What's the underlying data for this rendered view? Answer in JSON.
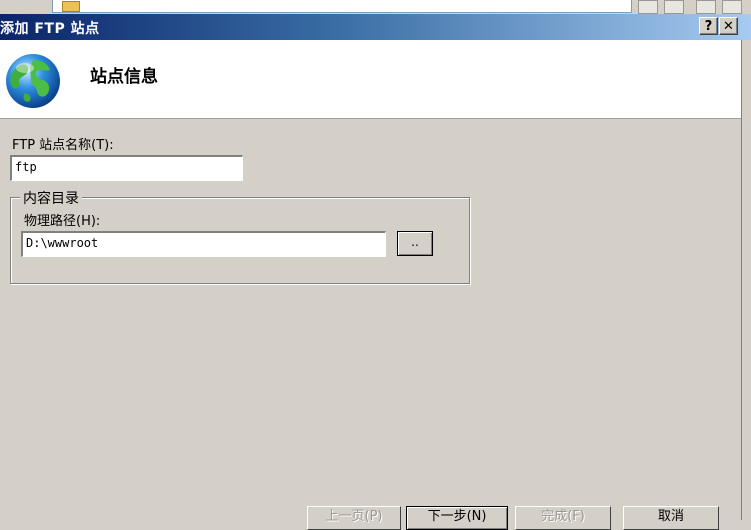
{
  "dialog": {
    "title": "添加 FTP 站点",
    "help_button": "?",
    "close_button": "✕"
  },
  "header": {
    "title": "站点信息"
  },
  "form": {
    "site_name_label": "FTP 站点名称(T):",
    "site_name_value": "ftp",
    "content_group_label": "内容目录",
    "physical_path_label": "物理路径(H):",
    "physical_path_value": "D:\\wwwroot",
    "browse_label": ".."
  },
  "buttons": {
    "previous": "上一页(P)",
    "next": "下一步(N)",
    "finish": "完成(F)",
    "cancel": "取消"
  }
}
